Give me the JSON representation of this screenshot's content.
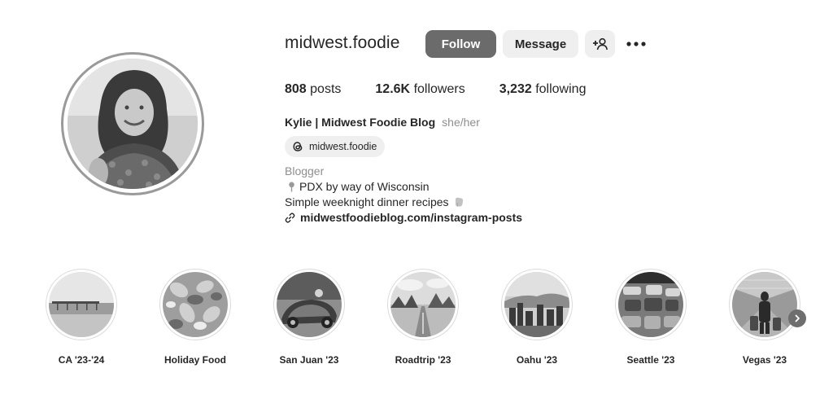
{
  "profile": {
    "username": "midwest.foodie",
    "follow_label": "Follow",
    "message_label": "Message",
    "stats": {
      "posts_count": "808",
      "posts_label": "posts",
      "followers_count": "12.6K",
      "followers_label": "followers",
      "following_count": "3,232",
      "following_label": "following"
    },
    "full_name": "Kylie | Midwest Foodie Blog",
    "pronouns": "she/her",
    "threads_handle": "midwest.foodie",
    "category": "Blogger",
    "bio_lines": [
      "PDX by way of Wisconsin",
      "Simple weeknight dinner recipes"
    ],
    "link": "midwestfoodieblog.com/instagram-posts"
  },
  "highlights": [
    {
      "label": "CA '23-'24"
    },
    {
      "label": "Holiday Food"
    },
    {
      "label": "San Juan '23"
    },
    {
      "label": "Roadtrip '23"
    },
    {
      "label": "Oahu '23"
    },
    {
      "label": "Seattle '23"
    },
    {
      "label": "Vegas '23"
    }
  ],
  "icons": {
    "suggest": "add-person-icon",
    "more": "more-options-icon",
    "threads": "threads-icon",
    "pin": "pin-icon",
    "link": "link-icon",
    "next": "chevron-right-icon"
  },
  "colors": {
    "follow_button": "#6b6b6b",
    "secondary_button": "#efefef",
    "muted_text": "#8e8e8e",
    "text": "#262626"
  }
}
